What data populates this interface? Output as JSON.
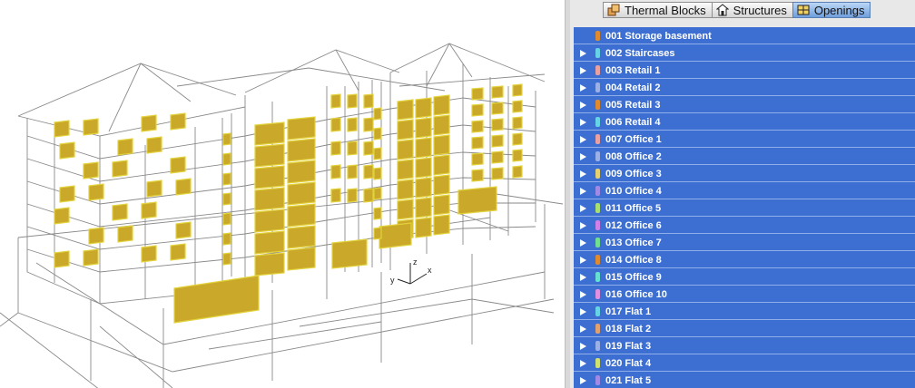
{
  "tabs": [
    {
      "label": "Thermal Blocks",
      "icon": "thermal-blocks-icon",
      "active": false
    },
    {
      "label": "Structures",
      "icon": "house-icon",
      "active": false
    },
    {
      "label": "Openings",
      "icon": "window-icon",
      "active": true
    }
  ],
  "axis": {
    "x": "x",
    "y": "y",
    "z": "z"
  },
  "colors": {
    "list_bg": "#3d6fd2",
    "glazing": "#c9a82a",
    "wire": "#8a8a8a"
  },
  "list_items": [
    {
      "label": "001 Storage basement",
      "color": "#e08a2e",
      "expandable": false
    },
    {
      "label": "002 Staircases",
      "color": "#66d4e6",
      "expandable": true
    },
    {
      "label": "003 Retail 1",
      "color": "#e8a0a0",
      "expandable": true
    },
    {
      "label": "004 Retail 2",
      "color": "#9ab0e6",
      "expandable": true
    },
    {
      "label": "005 Retail 3",
      "color": "#e08a2e",
      "expandable": true
    },
    {
      "label": "006 Retail 4",
      "color": "#66d4e6",
      "expandable": true
    },
    {
      "label": "007 Office 1",
      "color": "#e8a0a0",
      "expandable": true
    },
    {
      "label": "008 Office 2",
      "color": "#9ab0e6",
      "expandable": true
    },
    {
      "label": "009 Office 3",
      "color": "#e6d070",
      "expandable": true
    },
    {
      "label": "010 Office 4",
      "color": "#a08ae6",
      "expandable": true
    },
    {
      "label": "011 Office 5",
      "color": "#a8e070",
      "expandable": true
    },
    {
      "label": "012 Office 6",
      "color": "#d080e6",
      "expandable": true
    },
    {
      "label": "013 Office 7",
      "color": "#70e090",
      "expandable": true
    },
    {
      "label": "014 Office 8",
      "color": "#e08a2e",
      "expandable": true
    },
    {
      "label": "015 Office 9",
      "color": "#66e0d0",
      "expandable": true
    },
    {
      "label": "016 Office 10",
      "color": "#e090e0",
      "expandable": true
    },
    {
      "label": "017 Flat 1",
      "color": "#66d4e6",
      "expandable": true
    },
    {
      "label": "018 Flat 2",
      "color": "#e0a070",
      "expandable": true
    },
    {
      "label": "019 Flat 3",
      "color": "#9ab0e6",
      "expandable": true
    },
    {
      "label": "020 Flat 4",
      "color": "#d0e070",
      "expandable": true
    },
    {
      "label": "021 Flat 5",
      "color": "#a08ae6",
      "expandable": true
    }
  ]
}
